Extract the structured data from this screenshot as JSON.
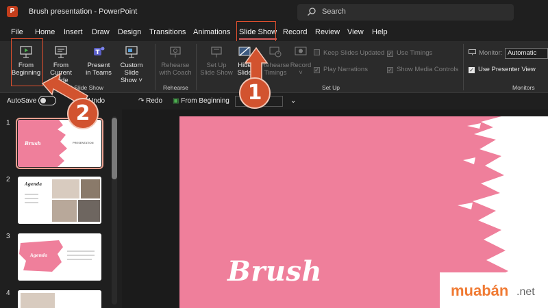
{
  "titlebar": {
    "app_logo": "P",
    "doc_title": "Brush presentation  -  PowerPoint",
    "search_placeholder": "Search"
  },
  "menu": {
    "tabs": [
      {
        "label": "File"
      },
      {
        "label": "Home"
      },
      {
        "label": "Insert"
      },
      {
        "label": "Draw"
      },
      {
        "label": "Design"
      },
      {
        "label": "Transitions"
      },
      {
        "label": "Animations"
      },
      {
        "label": "Slide Show"
      },
      {
        "label": "Record"
      },
      {
        "label": "Review"
      },
      {
        "label": "View"
      },
      {
        "label": "Help"
      }
    ],
    "active": "Slide Show"
  },
  "ribbon": {
    "start_group": {
      "label": "Start Slide Show",
      "from_beginning": [
        "From",
        "Beginning"
      ],
      "from_current": [
        "From",
        "Current Slide"
      ],
      "present_teams": [
        "Present",
        "in Teams"
      ],
      "custom_show": [
        "Custom Slide",
        "Show ˅"
      ]
    },
    "rehearse_group": {
      "label": "Rehearse",
      "rehearse_coach": [
        "Rehearse",
        "with Coach"
      ]
    },
    "setup_group": {
      "label": "Set Up",
      "setup_show": [
        "Set Up",
        "Slide Show"
      ],
      "hide_slide": [
        "Hide",
        "Slide"
      ],
      "rehearse_timings": [
        "Rehearse",
        "Timings"
      ],
      "record": [
        "Record",
        "˅"
      ],
      "keep_updated": "Keep Slides Updated",
      "play_narrations": "Play Narrations",
      "use_timings": "Use Timings",
      "show_media": "Show Media Controls"
    },
    "monitors_group": {
      "label": "Monitors",
      "monitor_label": "Monitor:",
      "monitor_value": "Automatic",
      "use_presenter": "Use Presenter View"
    }
  },
  "qat": {
    "autosave": "AutoSave",
    "undo": "Undo",
    "redo": "Redo",
    "from_beginning": "From Beginning",
    "customize": "⌄"
  },
  "thumbnails": [
    {
      "num": "1",
      "title": "Brush",
      "subtitle": "PRESENTATION"
    },
    {
      "num": "2",
      "title": "Agenda"
    },
    {
      "num": "3",
      "title": "Agenda"
    },
    {
      "num": "4"
    }
  ],
  "slide": {
    "title": "Brush",
    "background": "#ef7f9b"
  },
  "annotations": {
    "step1": "1",
    "step2": "2"
  },
  "watermark": {
    "brand": "muabán",
    "suffix": ".net"
  },
  "colors": {
    "accent": "#d2532f",
    "slide_pink": "#ef7f9b",
    "highlight": "#e2502e"
  }
}
